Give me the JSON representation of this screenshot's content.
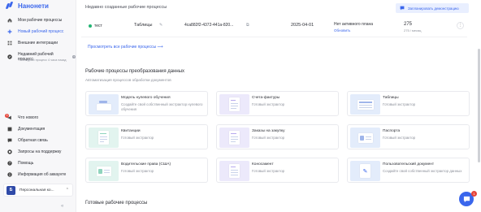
{
  "app": {
    "logo_text": "Нанонети"
  },
  "sidebar": {
    "items": [
      {
        "label": "Мои рабочие процессы",
        "icon": "home-icon"
      },
      {
        "label": "Новый рабочий процесс",
        "icon": "plus-icon",
        "active": true
      },
      {
        "label": "Внешние интеграции",
        "icon": "grid-icon"
      },
      {
        "label": "Недавний рабочий процесс",
        "icon": "compass-icon",
        "sub": "Последний процесс 4 часа назад"
      }
    ],
    "bottom_items": [
      {
        "label": "Что нового",
        "icon": "megaphone-icon",
        "badge": "3"
      },
      {
        "label": "Документация",
        "icon": "book-icon"
      },
      {
        "label": "Обратная связь",
        "icon": "chat-icon"
      },
      {
        "label": "Запросы на поддержку",
        "icon": "support-icon"
      },
      {
        "label": "Помощь",
        "icon": "help-icon"
      },
      {
        "label": "Информация об аккаунте",
        "icon": "info-icon"
      }
    ],
    "account": {
      "avatar": "Б",
      "name": "Персональная ко..."
    }
  },
  "main": {
    "recent_title": "Недавно созданные рабочие процессы",
    "demo_button": "Запланировать демонстрацию",
    "row": {
      "name": "тест",
      "type": "Таблицы",
      "id": "4ca882f2-4372-441a-820...",
      "date": "2025-04-01",
      "plan": "Нет активного плана",
      "update": "Обновить",
      "count": "275",
      "month": "275 / месяц"
    },
    "view_all": "Просмотреть все рабочие процессы ⟶",
    "transform_title": "Рабочие процессы преобразования данных",
    "transform_sub": "Автоматизация процессов обработки документов",
    "cards": [
      {
        "title": "Модель нулевого обучения",
        "desc": "Создайте свой собственный экстрактор нулевого обучения",
        "color": "#e3ecfb"
      },
      {
        "title": "Счета-фактуры",
        "desc": "Готовый экстрактор",
        "color": "#ece9fb"
      },
      {
        "title": "Таблицы",
        "desc": "Готовый экстрактор",
        "color": "#e3ecfb"
      },
      {
        "title": "Квитанции",
        "desc": "Готовый экстрактор",
        "color": "#e2f4ef"
      },
      {
        "title": "Заказы на закупку",
        "desc": "Готовый экстрактор",
        "color": "#ece9fb"
      },
      {
        "title": "Паспорта",
        "desc": "Готовый экстрактор",
        "color": "#e3ecfb"
      },
      {
        "title": "Водительские права (США)",
        "desc": "Готовый экстрактор",
        "color": "#e2f4ef"
      },
      {
        "title": "Коносамент",
        "desc": "Готовый экстрактор",
        "color": "#ece9fb"
      },
      {
        "title": "Пользовательский документ",
        "desc": "Создайте свой собственный экстрактор данных",
        "color": "#e3ecfb"
      }
    ],
    "ready_title": "Готовые рабочие процессы",
    "chat_badge": "1"
  }
}
